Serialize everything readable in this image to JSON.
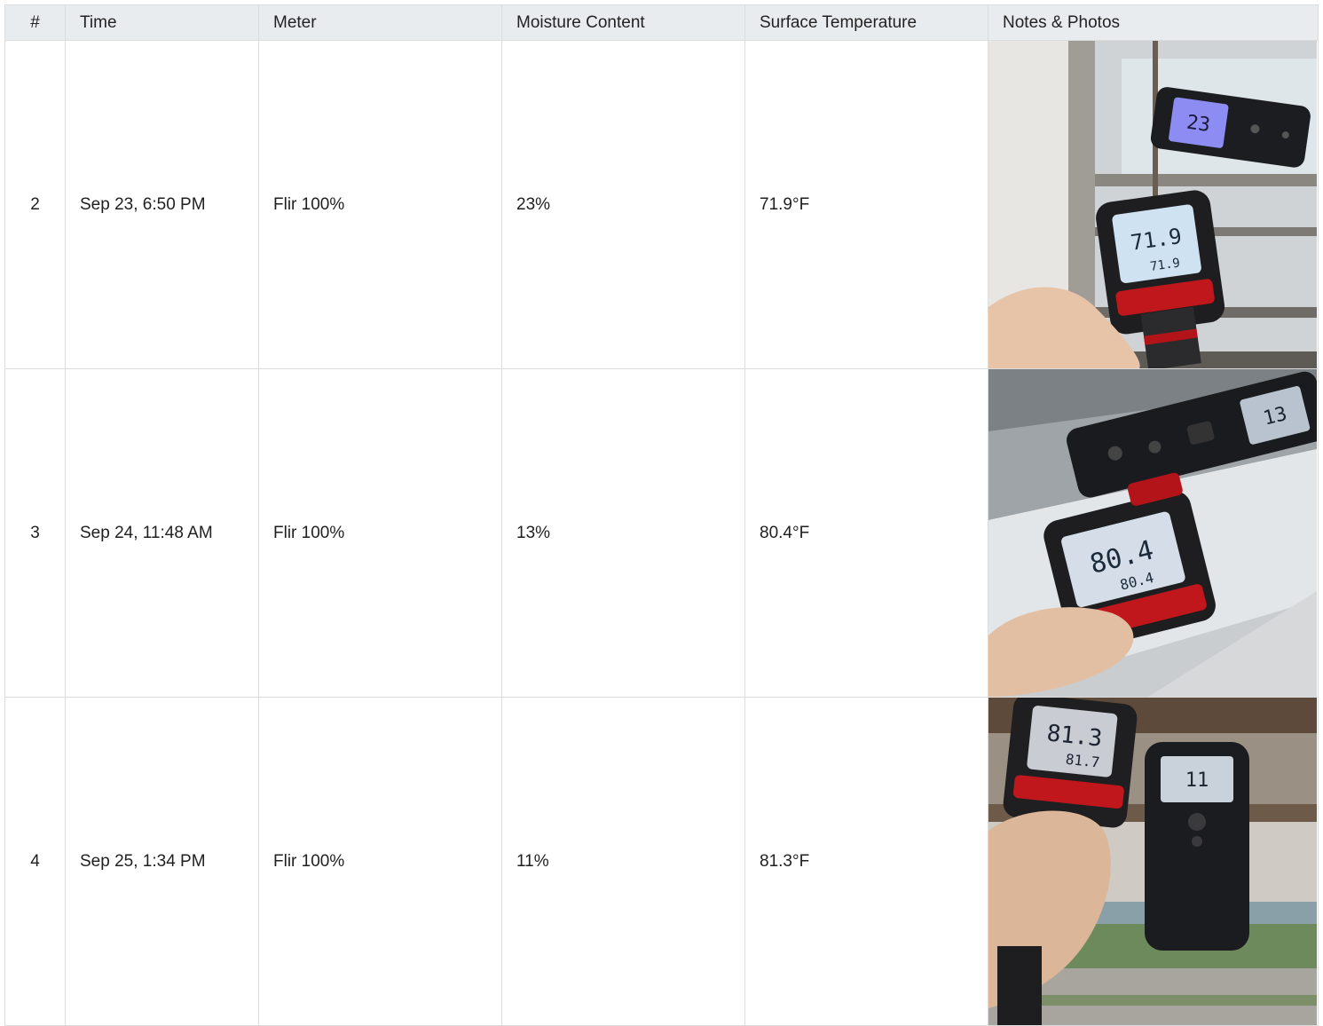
{
  "columns": {
    "num": "#",
    "time": "Time",
    "meter": "Meter",
    "moisture": "Moisture Content",
    "surface_temp": "Surface Temperature",
    "notes": "Notes & Photos"
  },
  "rows": [
    {
      "num": "2",
      "time": "Sep 23, 6:50 PM",
      "meter": "Flir 100%",
      "moisture": "23%",
      "surface_temp": "71.9°F",
      "photo": {
        "gun_main": "71.9",
        "gun_sub": "71.9",
        "meter_reading": "23"
      }
    },
    {
      "num": "3",
      "time": "Sep 24, 11:48 AM",
      "meter": "Flir 100%",
      "moisture": "13%",
      "surface_temp": "80.4°F",
      "photo": {
        "gun_main": "80.4",
        "gun_sub": "80.4",
        "meter_reading": "13"
      }
    },
    {
      "num": "4",
      "time": "Sep 25, 1:34 PM",
      "meter": "Flir 100%",
      "moisture": "11%",
      "surface_temp": "81.3°F",
      "photo": {
        "gun_main": "81.3",
        "gun_sub": "81.7",
        "meter_reading": "11"
      }
    }
  ]
}
